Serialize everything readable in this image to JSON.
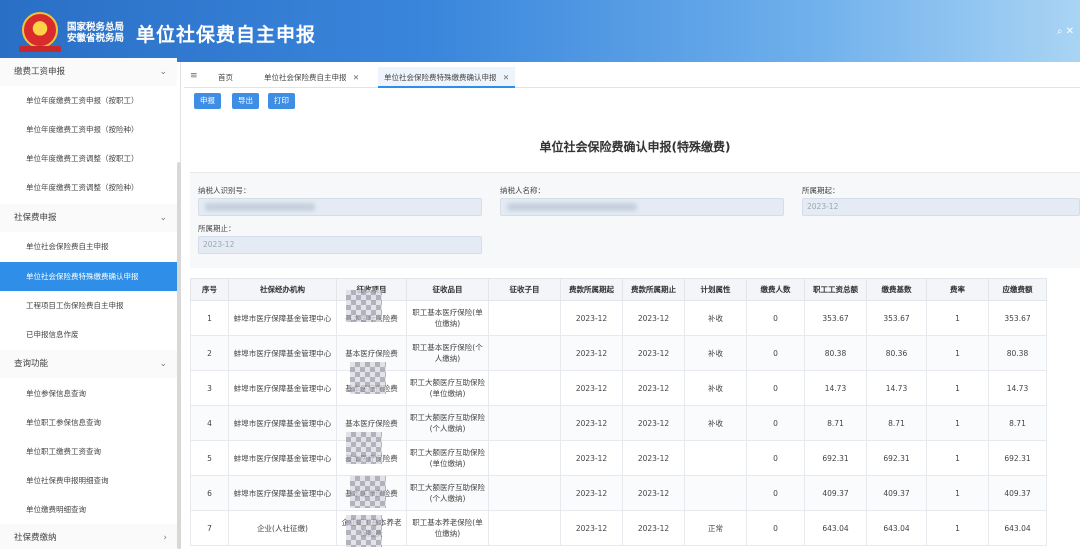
{
  "header": {
    "org_line1": "国家税务总局",
    "org_line2": "安徽省税务局",
    "app_title": "单位社保费自主申报",
    "controls": "⌕ ✕"
  },
  "sidebar": {
    "groups": [
      {
        "label": "缴费工资申报",
        "expanded": true,
        "items": [
          "单位年度缴费工资申报（按职工）",
          "单位年度缴费工资申报（按险种）",
          "单位年度缴费工资调整（按职工）",
          "单位年度缴费工资调整（按险种）"
        ]
      },
      {
        "label": "社保费申报",
        "expanded": true,
        "items": [
          "单位社会保险费自主申报",
          "单位社会保险费特殊缴费确认申报",
          "工程项目工伤保险费自主申报",
          "已申报信息作废"
        ]
      },
      {
        "label": "查询功能",
        "expanded": true,
        "items": [
          "单位参保信息查询",
          "单位职工参保信息查询",
          "单位职工缴费工资查询",
          "单位社保费申报明细查询",
          "单位缴费明细查询"
        ]
      },
      {
        "label": "社保费缴纳",
        "expanded": false,
        "items": []
      }
    ],
    "active_item": "单位社会保险费特殊缴费确认申报"
  },
  "tabs": {
    "menu_icon": "≡",
    "items": [
      {
        "label": "首页",
        "closable": false
      },
      {
        "label": "单位社会保险费自主申报",
        "closable": true
      },
      {
        "label": "单位社会保险费特殊缴费确认申报",
        "closable": true,
        "active": true
      }
    ],
    "close_glyph": "✕"
  },
  "toolbar": {
    "declare": "申报",
    "export": "导出",
    "print": "打印"
  },
  "form": {
    "title": "单位社会保险费确认申报(特殊缴费)",
    "taxpayer_id_label": "纳税人识别号：",
    "taxpayer_name_label": "纳税人名称：",
    "period_start_label": "所属期起：",
    "period_start_value": "2023-12",
    "period_end_label": "所属期止：",
    "period_end_value": "2023-12"
  },
  "table": {
    "columns": [
      "序号",
      "社保经办机构",
      "征收项目",
      "征收品目",
      "征收子目",
      "费款所属期起",
      "费款所属期止",
      "计划属性",
      "缴费人数",
      "职工工资总额",
      "缴费基数",
      "费率",
      "应缴费额"
    ],
    "rows": [
      [
        "1",
        "蚌埠市医疗保障基金管理中心",
        "基本医疗保险费",
        "职工基本医疗保险(单位缴纳)",
        "",
        "2023-12",
        "2023-12",
        "补收",
        "0",
        "353.67",
        "353.67",
        "1",
        "353.67"
      ],
      [
        "2",
        "蚌埠市医疗保障基金管理中心",
        "基本医疗保险费",
        "职工基本医疗保险(个人缴纳)",
        "",
        "2023-12",
        "2023-12",
        "补收",
        "0",
        "80.38",
        "80.36",
        "1",
        "80.38"
      ],
      [
        "3",
        "蚌埠市医疗保障基金管理中心",
        "基本医疗保险费",
        "职工大额医疗互助保险(单位缴纳)",
        "",
        "2023-12",
        "2023-12",
        "补收",
        "0",
        "14.73",
        "14.73",
        "1",
        "14.73"
      ],
      [
        "4",
        "蚌埠市医疗保障基金管理中心",
        "基本医疗保险费",
        "职工大额医疗互助保险(个人缴纳)",
        "",
        "2023-12",
        "2023-12",
        "补收",
        "0",
        "8.71",
        "8.71",
        "1",
        "8.71"
      ],
      [
        "5",
        "蚌埠市医疗保障基金管理中心",
        "基本医疗保险费",
        "职工大额医疗互助保险(单位缴纳)",
        "",
        "2023-12",
        "2023-12",
        "",
        "0",
        "692.31",
        "692.31",
        "1",
        "692.31"
      ],
      [
        "6",
        "蚌埠市医疗保障基金管理中心",
        "基本医疗保险费",
        "职工大额医疗互助保险(个人缴纳)",
        "",
        "2023-12",
        "2023-12",
        "",
        "0",
        "409.37",
        "409.37",
        "1",
        "409.37"
      ],
      [
        "7",
        "企业(人社征缴)",
        "企业职工基本养老保险费",
        "职工基本养老保险(单位缴纳)",
        "",
        "2023-12",
        "2023-12",
        "正常",
        "0",
        "643.04",
        "643.04",
        "1",
        "643.04"
      ]
    ]
  }
}
